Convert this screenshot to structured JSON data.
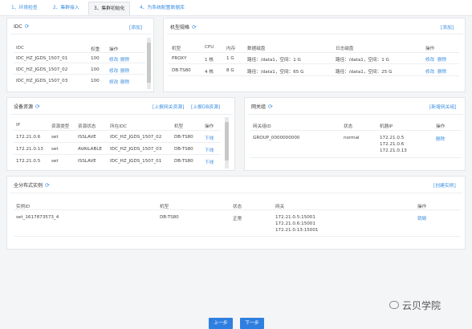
{
  "tabs": [
    "1、环境检查",
    "2、集群接入",
    "3、集群初始化",
    "4、为系统配置数据库"
  ],
  "idc": {
    "title": "IDC",
    "add": "[添加]",
    "headers": [
      "IDC",
      "权重",
      "操作"
    ],
    "rows": [
      {
        "name": "IDC_HZ_JGDS_1507_01",
        "weight": "100",
        "edit": "修改",
        "del": "删除"
      },
      {
        "name": "IDC_HZ_JGDS_1507_02",
        "weight": "100",
        "edit": "修改",
        "del": "删除"
      },
      {
        "name": "IDC_HZ_JGDS_1507_03",
        "weight": "100",
        "edit": "修改",
        "del": "删除"
      }
    ]
  },
  "models": {
    "title": "机型规格",
    "add": "[添加]",
    "headers": [
      "机型",
      "CPU",
      "内存",
      "数据磁盘",
      "日志磁盘",
      "操作"
    ],
    "rows": [
      {
        "model": "PROXY",
        "cpu": "1 核",
        "mem": "1 G",
        "data": "路径：/data1，空间：1 G",
        "log": "路径：/data1，空间：1 G",
        "edit": "修改",
        "del": "删除"
      },
      {
        "model": "DB-TS80",
        "cpu": "4 核",
        "mem": "8 G",
        "data": "路径：/data1，空间：65 G",
        "log": "路径：/data1，空间：25 G",
        "edit": "修改",
        "del": "删除"
      }
    ]
  },
  "resources": {
    "title": "设备资源",
    "link1": "[上报网关资源]",
    "link2": "[上报DB资源]",
    "headers": [
      "IP",
      "资源类型",
      "资源状态",
      "所在IDC",
      "机型",
      "操作"
    ],
    "rows": [
      {
        "ip": "172.21.0.6",
        "type": "set",
        "status": "ISSLAVE",
        "idc": "IDC_HZ_JGDS_1507_02",
        "model": "DB-TS80",
        "op": "下线"
      },
      {
        "ip": "172.21.0.13",
        "type": "set",
        "status": "AVAILABLE",
        "idc": "IDC_HZ_JGDS_1507_03",
        "model": "DB-TS80",
        "op": "下线"
      },
      {
        "ip": "172.21.0.5",
        "type": "set",
        "status": "ISSLAVE",
        "idc": "IDC_HZ_JGDS_1507_01",
        "model": "DB-TS80",
        "op": "下线"
      }
    ]
  },
  "gateway": {
    "title": "网关组",
    "add": "[新增网关组]",
    "headers": [
      "网关组ID",
      "状态",
      "机器IP",
      "操作"
    ],
    "rows": [
      {
        "id": "GROUP_0000000000",
        "status": "normal",
        "ips": [
          "172.21.0.5",
          "172.21.0.6",
          "172.21.0.13"
        ],
        "del": "删除"
      }
    ]
  },
  "instances": {
    "title": "全分布式实例",
    "add": "[创建实例]",
    "headers": [
      "实例ID",
      "机型",
      "状态",
      "网关",
      "操作"
    ],
    "rows": [
      {
        "id": "set_1617873573_4",
        "model": "DB-TS80",
        "status": "正常",
        "gateways": [
          "172.21.0.5:15001",
          "172.21.0.6:15001",
          "172.21.0.13:15001"
        ],
        "op": "销毁"
      }
    ]
  },
  "buttons": {
    "prev": "上一步",
    "next": "下一步"
  },
  "watermark": "云贝学院",
  "icons": {
    "refresh": "refresh-icon",
    "wechat": "wechat-icon"
  },
  "colors": {
    "link": "#3a8de0",
    "button": "#2f7fe0"
  }
}
